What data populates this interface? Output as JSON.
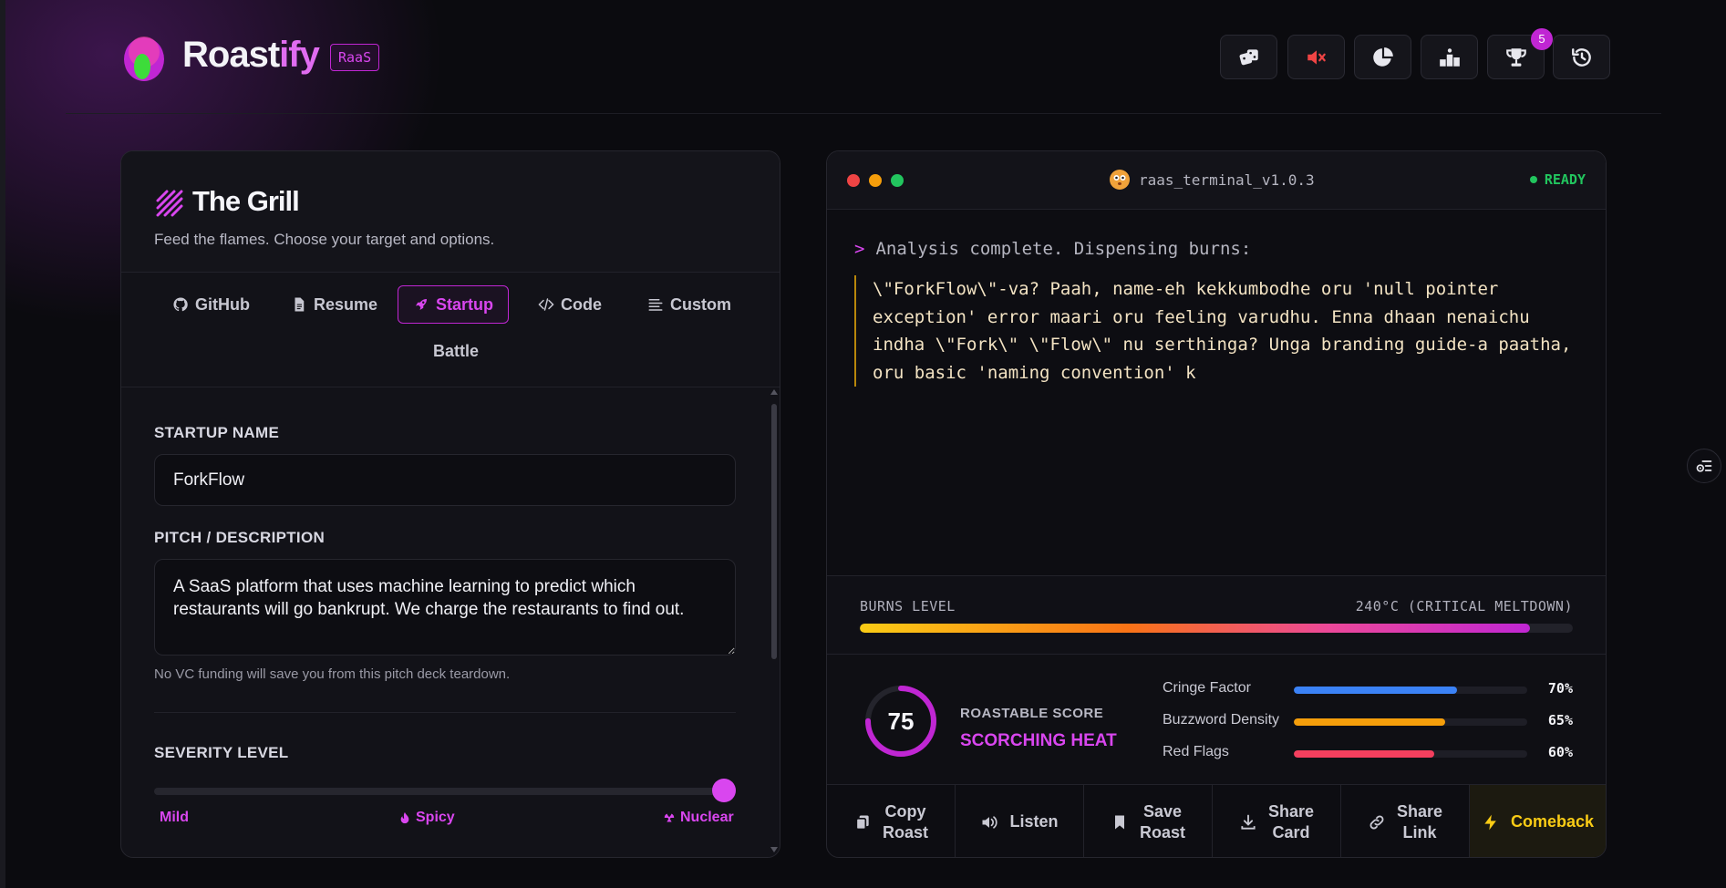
{
  "app": {
    "brand_main": "Roast",
    "brand_accent": "ify",
    "tag": "RaaS",
    "accent_color": "#d946ef"
  },
  "header": {
    "buttons": [
      {
        "icon": "dice-icon"
      },
      {
        "icon": "mute-icon",
        "color": "#ef4444"
      },
      {
        "icon": "pie-chart-icon"
      },
      {
        "icon": "podium-icon"
      },
      {
        "icon": "trophy-icon",
        "badge": "5"
      },
      {
        "icon": "history-icon"
      }
    ]
  },
  "grill": {
    "title": "The Grill",
    "subtitle": "Feed the flames. Choose your target and options.",
    "tabs": [
      {
        "label": "GitHub",
        "icon": "github-icon"
      },
      {
        "label": "Resume",
        "icon": "document-icon"
      },
      {
        "label": "Startup",
        "icon": "rocket-icon",
        "active": true
      },
      {
        "label": "Code",
        "icon": "code-icon"
      },
      {
        "label": "Custom",
        "icon": "lines-icon"
      },
      {
        "label": "Battle"
      }
    ],
    "startup_label": "STARTUP NAME",
    "startup_value": "ForkFlow",
    "pitch_label": "PITCH / DESCRIPTION",
    "pitch_value": "A SaaS platform that uses machine learning to predict which restaurants will go bankrupt. We charge the restaurants to find out.",
    "pitch_hint": "No VC funding will save you from this pitch deck teardown.",
    "severity_label": "SEVERITY LEVEL",
    "severity_level": 1.0,
    "severity_options": [
      "Mild",
      "Spicy",
      "Nuclear"
    ]
  },
  "terminal": {
    "title": "raas_terminal_v1.0.3",
    "status": "READY",
    "prompt_symbol": ">",
    "prompt_text": "Analysis complete. Dispensing burns:",
    "roast": "\\\"ForkFlow\\\"-va? Paah, name-eh kekkumbodhe oru 'null pointer exception' error maari oru feeling varudhu. Enna dhaan nenaichu indha \\\"Fork\\\" \\\"Flow\\\" nu serthinga? Unga branding guide-a paatha, oru basic 'naming convention' k",
    "burns_label": "BURNS LEVEL",
    "burns_value": "240°C (CRITICAL MELTDOWN)",
    "burns_fill": 0.94,
    "score_value": "75",
    "score_fraction": 0.75,
    "score_label": "ROASTABLE SCORE",
    "score_heat": "SCORCHING HEAT",
    "metrics": [
      {
        "name": "Cringe Factor",
        "pct": "70%",
        "fill": 0.7,
        "color": "#3b82f6"
      },
      {
        "name": "Buzzword Density",
        "pct": "65%",
        "fill": 0.65,
        "color": "#f59e0b"
      },
      {
        "name": "Red Flags",
        "pct": "60%",
        "fill": 0.6,
        "color": "#f43f5e"
      }
    ],
    "actions": [
      {
        "label_1": "Copy",
        "label_2": "Roast",
        "icon": "copy-icon"
      },
      {
        "label_1": "Listen",
        "label_2": "",
        "icon": "speaker-icon"
      },
      {
        "label_1": "Save",
        "label_2": "Roast",
        "icon": "bookmark-icon"
      },
      {
        "label_1": "Share",
        "label_2": "Card",
        "icon": "download-icon"
      },
      {
        "label_1": "Share",
        "label_2": "Link",
        "icon": "link-icon"
      },
      {
        "label_1": "Comeback",
        "label_2": "",
        "icon": "bolt-icon"
      }
    ]
  }
}
